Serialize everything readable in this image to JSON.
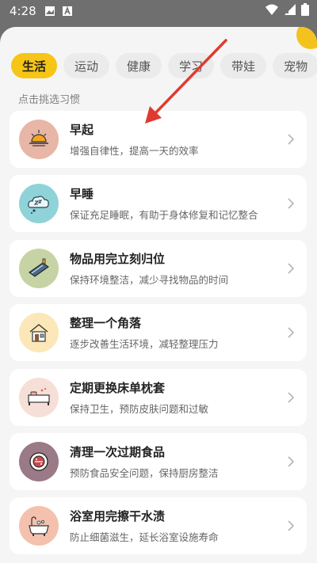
{
  "status_bar": {
    "time": "4:28",
    "left_icons": [
      "image-icon",
      "a-badge-icon"
    ],
    "right_icons": [
      "wifi-icon",
      "signal-icon",
      "battery-icon"
    ]
  },
  "tabs": [
    {
      "label": "生活",
      "active": true
    },
    {
      "label": "运动",
      "active": false
    },
    {
      "label": "健康",
      "active": false
    },
    {
      "label": "学习",
      "active": false
    },
    {
      "label": "带娃",
      "active": false
    },
    {
      "label": "宠物",
      "active": false
    }
  ],
  "section_label": "点击挑选习惯",
  "habits": [
    {
      "title": "早起",
      "desc": "增强自律性，提高一天的效率",
      "icon": "sunrise-icon",
      "icon_bg": "#e8b6a6"
    },
    {
      "title": "早睡",
      "desc": "保证充足睡眠，有助于身体修复和记忆整合",
      "icon": "sleep-cloud-icon",
      "icon_bg": "#8fd3d8"
    },
    {
      "title": "物品用完立刻归位",
      "desc": "保持环境整洁，减少寻找物品的时间",
      "icon": "tidy-shelf-icon",
      "icon_bg": "#c6d3a4"
    },
    {
      "title": "整理一个角落",
      "desc": "逐步改善生活环境，减轻整理压力",
      "icon": "house-corner-icon",
      "icon_bg": "#fbe7b8"
    },
    {
      "title": "定期更换床单枕套",
      "desc": "保持卫生，预防皮肤问题和过敏",
      "icon": "bed-icon",
      "icon_bg": "#f6dfd6"
    },
    {
      "title": "清理一次过期食品",
      "desc": "预防食品安全问题，保持厨房整洁",
      "icon": "food-plate-icon",
      "icon_bg": "#9a7a86"
    },
    {
      "title": "浴室用完擦干水渍",
      "desc": "防止细菌滋生，延长浴室设施寿命",
      "icon": "bathtub-icon",
      "icon_bg": "#f3c1ad"
    }
  ],
  "annotation": {
    "icon": "red-arrow-icon",
    "color": "#e03a2f"
  }
}
